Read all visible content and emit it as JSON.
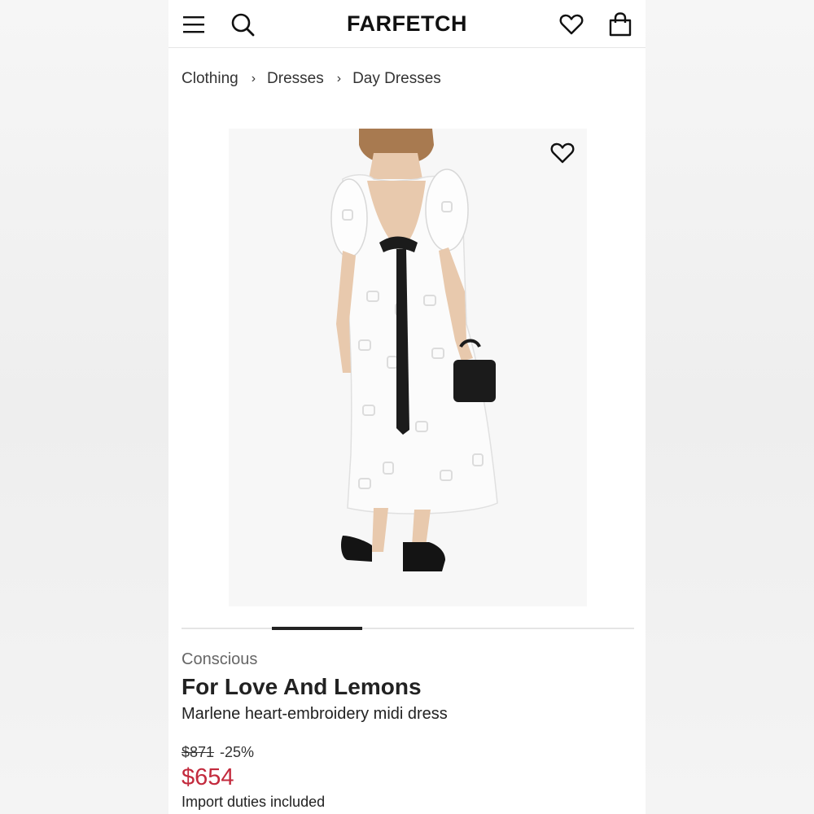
{
  "header": {
    "logo": "FARFETCH",
    "icons": [
      "menu-icon",
      "search-icon",
      "wishlist-heart-icon",
      "shopping-bag-icon"
    ]
  },
  "breadcrumb": [
    "Clothing",
    "Dresses",
    "Day Dresses"
  ],
  "breadcrumb_separator": "›",
  "product": {
    "tag": "Conscious",
    "brand": "For Love And Lemons",
    "name": "Marlene heart-embroidery midi dress",
    "original_price": "$871",
    "discount": "-25%",
    "sale_price": "$654",
    "duties_note": "Import duties included",
    "image_alt": "White heart-embroidery midi dress shown from behind with black bow tie, black mini bag and black loafers"
  },
  "carousel": {
    "active_index": 1,
    "total": 5
  },
  "colors": {
    "sale": "#c32a3d",
    "text": "#222222"
  }
}
